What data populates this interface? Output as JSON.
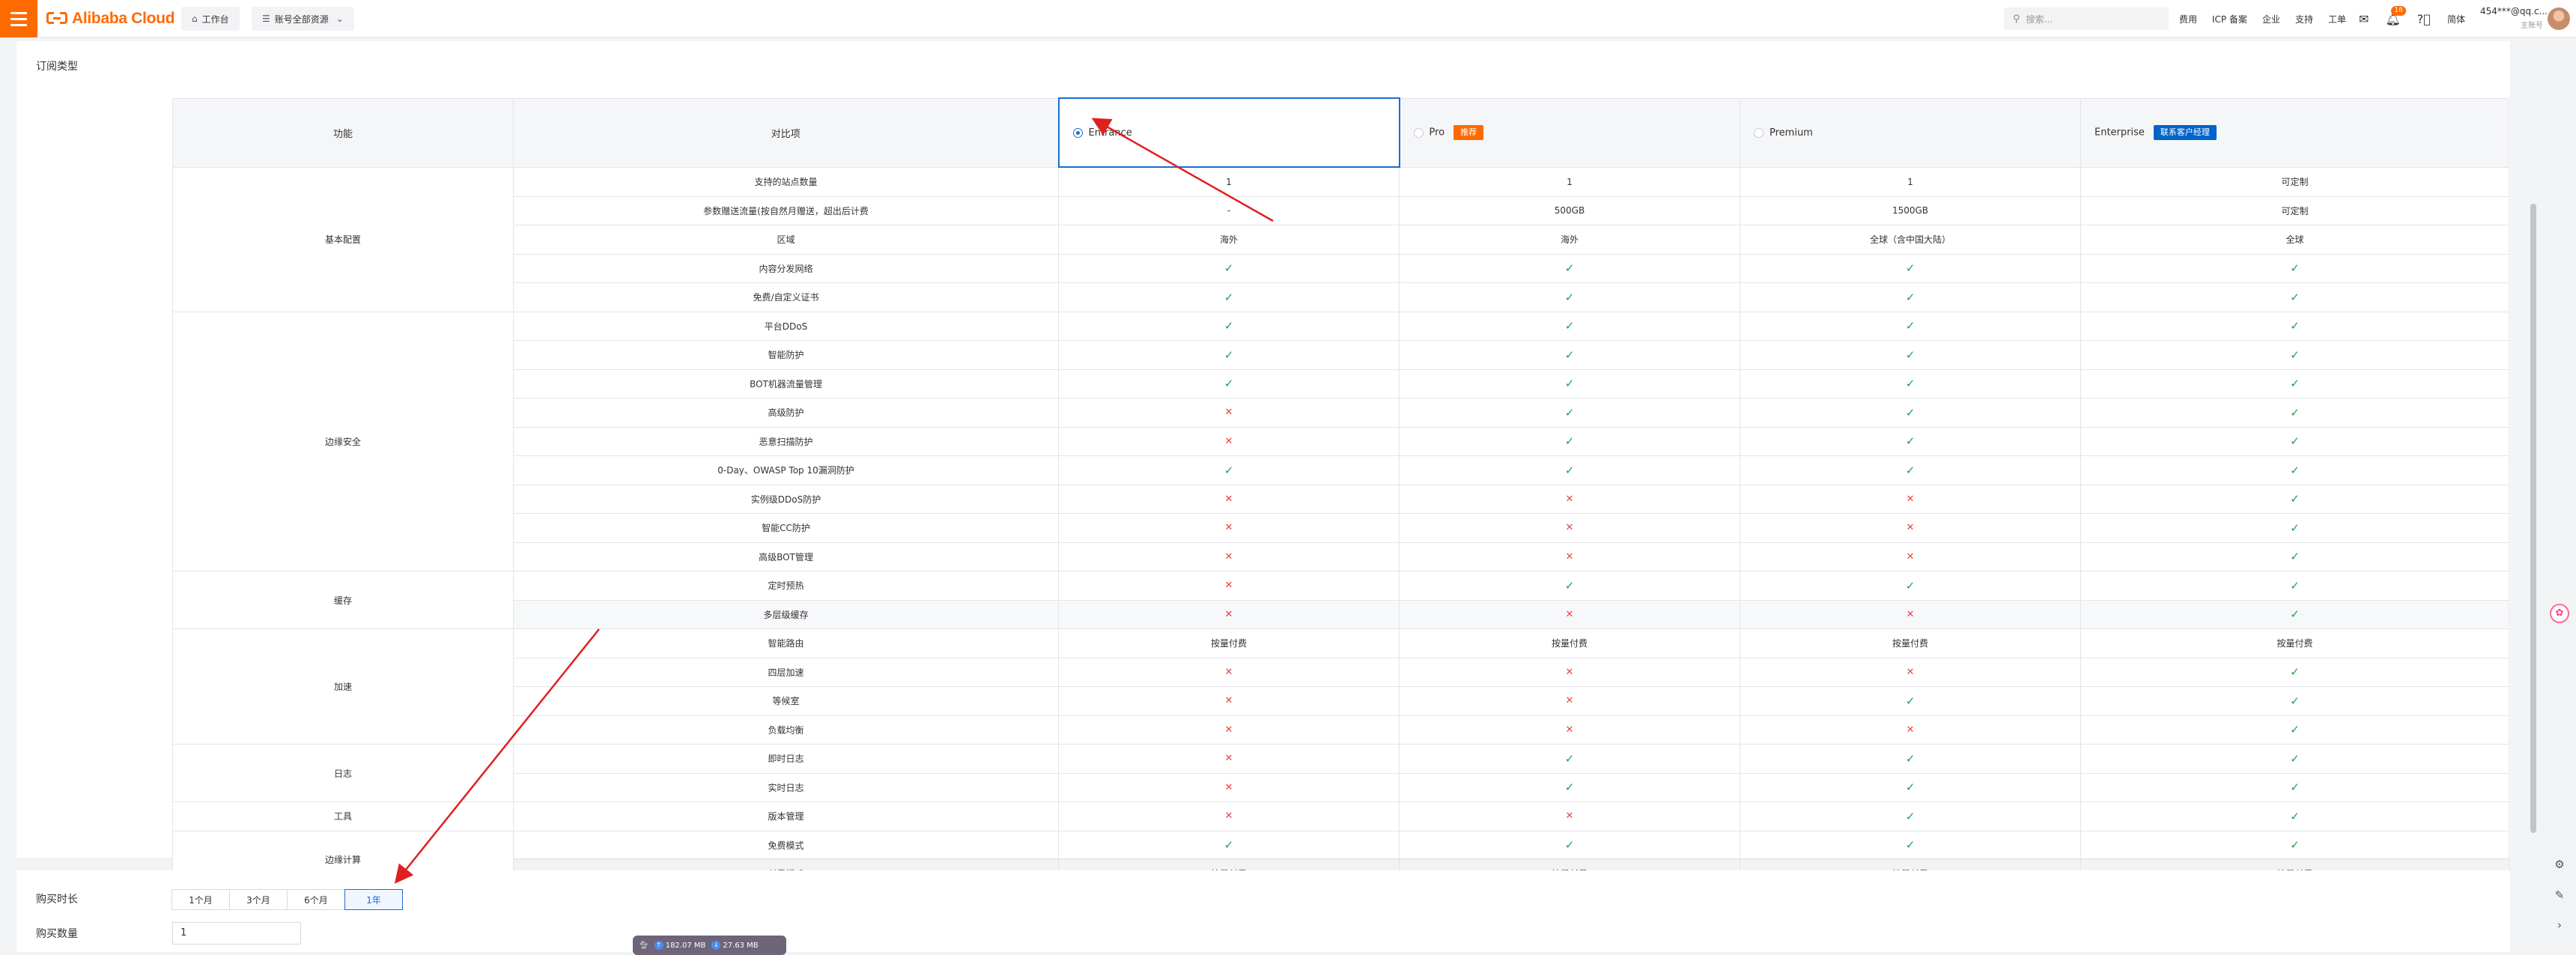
{
  "topbar": {
    "logo": "Alibaba Cloud",
    "workbench": "工作台",
    "resources": "账号全部资源",
    "search_placeholder": "搜索...",
    "links": [
      "费用",
      "ICP 备案",
      "企业",
      "支持",
      "工单"
    ],
    "notification_count": "18",
    "lang": "简体",
    "account": "454***@qq.c...",
    "role": "主账号"
  },
  "section": {
    "subscription_type": "订阅类型",
    "duration": "购买时长",
    "quantity": "购买数量"
  },
  "table": {
    "header": {
      "feature": "功能",
      "compare": "对比项",
      "plans": [
        {
          "name": "Entrance",
          "selected": true,
          "tag": ""
        },
        {
          "name": "Pro",
          "selected": false,
          "tag": "推荐"
        },
        {
          "name": "Premium",
          "selected": false,
          "tag": ""
        },
        {
          "name": "Enterprise",
          "selected": false,
          "tag": "联系客户经理"
        }
      ]
    },
    "groups": [
      {
        "name": "基本配置",
        "rows": [
          {
            "item": "支持的站点数量",
            "values": [
              "1",
              "1",
              "1",
              "可定制"
            ]
          },
          {
            "item": "参数赠送流量(按自然月赠送，超出后计费",
            "values": [
              "-",
              "500GB",
              "1500GB",
              "可定制"
            ]
          },
          {
            "item": "区域",
            "values": [
              "海外",
              "海外",
              "全球（含中国大陆）",
              "全球"
            ]
          },
          {
            "item": "内容分发网络",
            "values": [
              "Y",
              "Y",
              "Y",
              "Y"
            ]
          },
          {
            "item": "免费/自定义证书",
            "values": [
              "Y",
              "Y",
              "Y",
              "Y"
            ]
          }
        ]
      },
      {
        "name": "边缘安全",
        "rows": [
          {
            "item": "平台DDoS",
            "values": [
              "Y",
              "Y",
              "Y",
              "Y"
            ]
          },
          {
            "item": "智能防护",
            "values": [
              "Y",
              "Y",
              "Y",
              "Y"
            ]
          },
          {
            "item": "BOT机器流量管理",
            "values": [
              "Y",
              "Y",
              "Y",
              "Y"
            ]
          },
          {
            "item": "高级防护",
            "values": [
              "N",
              "Y",
              "Y",
              "Y"
            ]
          },
          {
            "item": "恶意扫描防护",
            "values": [
              "N",
              "Y",
              "Y",
              "Y"
            ]
          },
          {
            "item": "0-Day、OWASP Top 10漏洞防护",
            "values": [
              "Y",
              "Y",
              "Y",
              "Y"
            ]
          },
          {
            "item": "实例级DDoS防护",
            "values": [
              "N",
              "N",
              "N",
              "Y"
            ]
          },
          {
            "item": "智能CC防护",
            "values": [
              "N",
              "N",
              "N",
              "Y"
            ]
          },
          {
            "item": "高级BOT管理",
            "values": [
              "N",
              "N",
              "N",
              "Y"
            ]
          }
        ]
      },
      {
        "name": "缓存",
        "rows": [
          {
            "item": "定时预热",
            "values": [
              "N",
              "Y",
              "Y",
              "Y"
            ]
          },
          {
            "item": "多层级缓存",
            "values": [
              "N",
              "N",
              "N",
              "Y"
            ]
          }
        ]
      },
      {
        "name": "加速",
        "rows": [
          {
            "item": "智能路由",
            "values": [
              "按量付费",
              "按量付费",
              "按量付费",
              "按量付费"
            ]
          },
          {
            "item": "四层加速",
            "values": [
              "N",
              "N",
              "N",
              "Y"
            ]
          },
          {
            "item": "等候室",
            "values": [
              "N",
              "N",
              "Y",
              "Y"
            ]
          },
          {
            "item": "负载均衡",
            "values": [
              "N",
              "N",
              "N",
              "Y"
            ]
          }
        ]
      },
      {
        "name": "日志",
        "rows": [
          {
            "item": "即时日志",
            "values": [
              "N",
              "Y",
              "Y",
              "Y"
            ]
          },
          {
            "item": "实时日志",
            "values": [
              "N",
              "Y",
              "Y",
              "Y"
            ]
          }
        ]
      },
      {
        "name": "工具",
        "rows": [
          {
            "item": "版本管理",
            "values": [
              "N",
              "N",
              "Y",
              "Y"
            ]
          }
        ]
      },
      {
        "name": "边缘计算",
        "rows": [
          {
            "item": "免费模式",
            "values": [
              "Y",
              "Y",
              "Y",
              "Y"
            ]
          },
          {
            "item": "付费模式",
            "values": [
              "按量付费",
              "按量付费",
              "按量付费",
              "按量付费"
            ]
          }
        ]
      }
    ]
  },
  "purchase": {
    "duration_options": [
      "1个月",
      "3个月",
      "6个月",
      "1年"
    ],
    "duration_selected": "1年",
    "quantity_value": "1"
  },
  "floatbar": {
    "upload": "182.07 MB",
    "download": "27.63 MB"
  },
  "colors": {
    "brand": "#ff6a00",
    "selected": "#1a6ecf",
    "check": "#1aa34a",
    "cross": "#e54545",
    "annotation": "#e02020"
  },
  "icons": {
    "check": "check-icon",
    "cross": "cross-icon"
  }
}
